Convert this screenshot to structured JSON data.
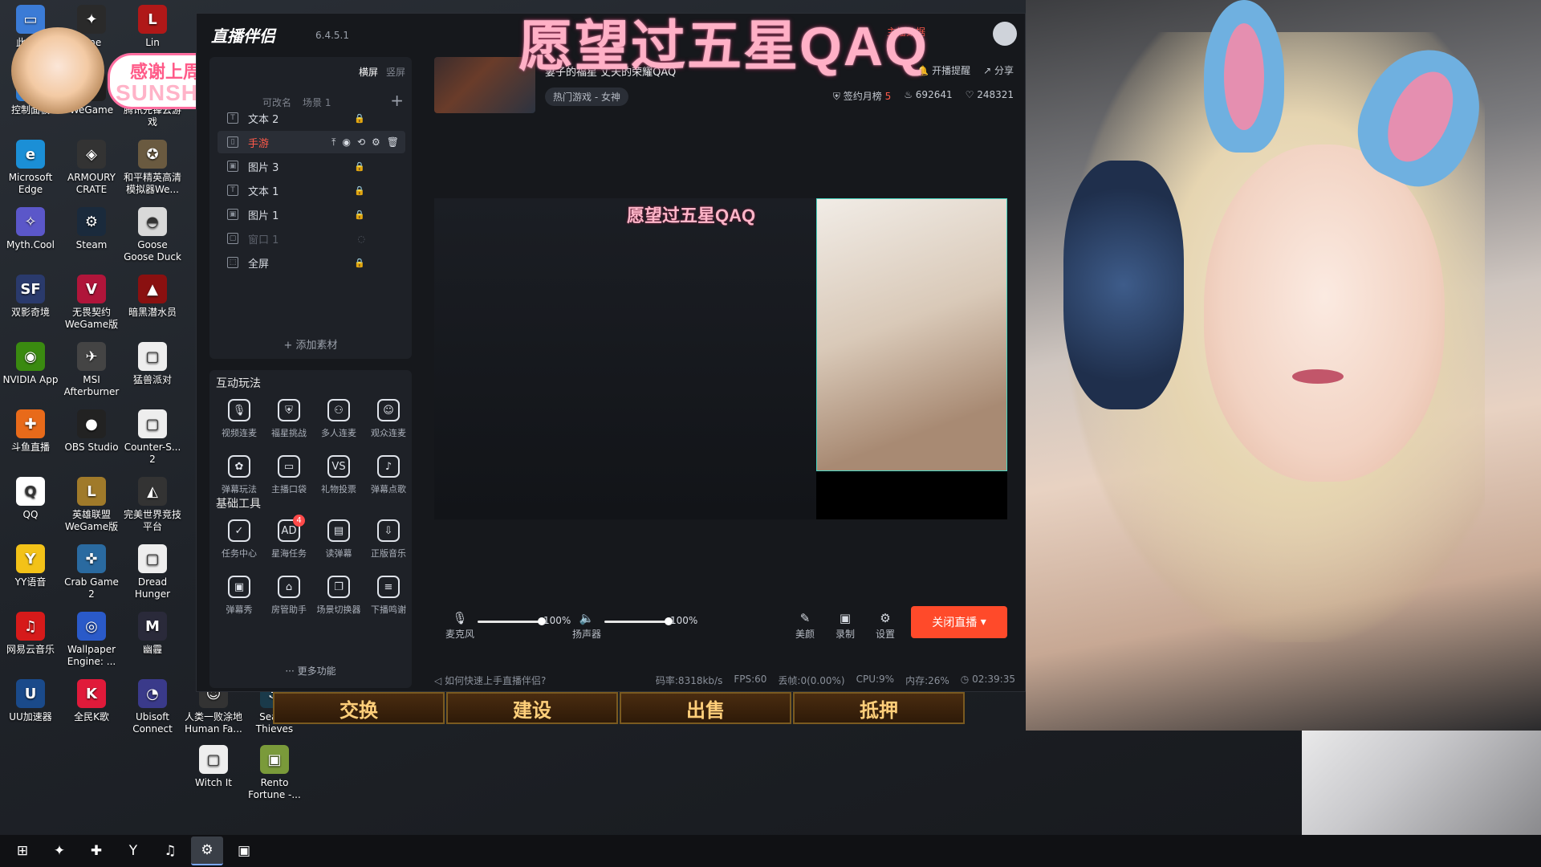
{
  "desktop": {
    "icons": [
      {
        "name": "此电脑",
        "color": "#3b7bd6",
        "glyph": "▭"
      },
      {
        "name": "One",
        "color": "#2a2a2a",
        "glyph": "✦"
      },
      {
        "name": "Lin",
        "color": "#b01818",
        "glyph": "L"
      },
      {
        "name": "控制面板",
        "color": "#2d7bd1",
        "glyph": "▦"
      },
      {
        "name": "WeGame",
        "color": "#1e1e1e",
        "glyph": "G"
      },
      {
        "name": "腾讯先锋云游戏",
        "color": "#4ac3d8",
        "glyph": "◆"
      },
      {
        "name": "Microsoft Edge",
        "color": "#1b8fd6",
        "glyph": "e"
      },
      {
        "name": "ARMOURY CRATE",
        "color": "#333",
        "glyph": "◈"
      },
      {
        "name": "和平精英高清模拟器We...",
        "color": "#6a5a40",
        "glyph": "✪"
      },
      {
        "name": "Myth.Cool",
        "color": "#5b57c9",
        "glyph": "✧"
      },
      {
        "name": "Steam",
        "color": "#1a2a3c",
        "glyph": "⚙"
      },
      {
        "name": "Goose Goose Duck",
        "color": "#d9d9d9",
        "glyph": "◓"
      },
      {
        "name": "双影奇境",
        "color": "#2a3a6c",
        "glyph": "SF"
      },
      {
        "name": "无畏契约 WeGame版",
        "color": "#b0153a",
        "glyph": "V"
      },
      {
        "name": "暗黑潜水员",
        "color": "#8a1010",
        "glyph": "▲"
      },
      {
        "name": "NVIDIA App",
        "color": "#3a8a10",
        "glyph": "◉"
      },
      {
        "name": "MSI Afterburner",
        "color": "#444",
        "glyph": "✈"
      },
      {
        "name": "猛兽派对",
        "color": "#eee",
        "glyph": "▢"
      },
      {
        "name": "斗鱼直播",
        "color": "#e86a1a",
        "glyph": "✚"
      },
      {
        "name": "OBS Studio",
        "color": "#222",
        "glyph": "●"
      },
      {
        "name": "Counter-S... 2",
        "color": "#eee",
        "glyph": "▢"
      },
      {
        "name": "QQ",
        "color": "#fff",
        "glyph": "Q"
      },
      {
        "name": "英雄联盟 WeGame版",
        "color": "#a07a2a",
        "glyph": "L"
      },
      {
        "name": "完美世界竞技平台",
        "color": "#333",
        "glyph": "◭"
      },
      {
        "name": "YY语音",
        "color": "#f3c218",
        "glyph": "Y"
      },
      {
        "name": "Crab Game 2",
        "color": "#2a6aa0",
        "glyph": "✜"
      },
      {
        "name": "Dread Hunger",
        "color": "#eee",
        "glyph": "▢"
      },
      {
        "name": "网易云音乐",
        "color": "#d61a1a",
        "glyph": "♫"
      },
      {
        "name": "Wallpaper Engine: ...",
        "color": "#2a5ac9",
        "glyph": "◎"
      },
      {
        "name": "幽霾",
        "color": "#2a2a3a",
        "glyph": "M"
      },
      {
        "name": "UU加速器",
        "color": "#1a4a8a",
        "glyph": "U"
      },
      {
        "name": "全民K歌",
        "color": "#e01a3a",
        "glyph": "K"
      },
      {
        "name": "Ubisoft Connect",
        "color": "#3a3a8a",
        "glyph": "◔"
      },
      {
        "name": "人类一败涂地 Human Fa...",
        "color": "#333",
        "glyph": "☺"
      },
      {
        "name": "Sea of Thieves",
        "color": "#1a3a4a",
        "glyph": "⚓"
      },
      {
        "name": "Witch It",
        "color": "#eee",
        "glyph": "▢"
      },
      {
        "name": "Rento Fortune -...",
        "color": "#7a9a3a",
        "glyph": "▣"
      }
    ]
  },
  "taskbar": {
    "items": [
      {
        "label": "start",
        "glyph": "⊞"
      },
      {
        "label": "app1",
        "glyph": "✦"
      },
      {
        "label": "app2",
        "glyph": "✚"
      },
      {
        "label": "yy",
        "glyph": "Y"
      },
      {
        "label": "netease",
        "glyph": "♫"
      },
      {
        "label": "steam",
        "glyph": "⚙"
      },
      {
        "label": "rento",
        "glyph": "▣"
      }
    ],
    "active_index": 5
  },
  "app": {
    "name": "直播伴侣",
    "version": "6.4.5.1",
    "orientation_tabs": [
      "横屏",
      "竖屏"
    ],
    "scene_tabs": [
      "可改名",
      "场景 1"
    ],
    "sources": [
      {
        "label": "文本 2",
        "type": "T",
        "state": "normal"
      },
      {
        "label": "手游",
        "type": "▯",
        "state": "active"
      },
      {
        "label": "图片 3",
        "type": "▣",
        "state": "normal"
      },
      {
        "label": "文本 1",
        "type": "T",
        "state": "normal"
      },
      {
        "label": "图片 1",
        "type": "▣",
        "state": "normal"
      },
      {
        "label": "窗口 1",
        "type": "▢",
        "state": "dim"
      },
      {
        "label": "全屏",
        "type": "⬚",
        "state": "normal"
      }
    ],
    "add_material": "添加素材",
    "interactive_title": "互动玩法",
    "interactive_tools": [
      "视频连麦",
      "福星挑战",
      "多人连麦",
      "观众连麦",
      "弹幕玩法",
      "主播口袋",
      "礼物投票",
      "弹幕点歌"
    ],
    "basic_title": "基础工具",
    "basic_tools": [
      "任务中心",
      "星海任务",
      "读弹幕",
      "正版音乐",
      "弹幕秀",
      "房管助手",
      "场景切换器",
      "下播鸣谢"
    ],
    "basic_badge": "4",
    "more_functions": "更多功能"
  },
  "stream": {
    "title": "妻子的福星 丈夫的荣耀QAQ",
    "category": "热门游戏 - 女神",
    "host_data": "主播数据",
    "broadcast_remind": "开播提醒",
    "share": "分享",
    "sign_month": "签约月榜",
    "sign_rank": "5",
    "popularity": "692641",
    "likes": "248321",
    "overlay_title": "愿望过五星QAQ",
    "preview_title": "愿望过五星QAQ"
  },
  "controls": {
    "mic_label": "麦克风",
    "mic_pct": "100%",
    "mic_level": 1.0,
    "speaker_label": "扬声器",
    "speaker_pct": "100%",
    "speaker_level": 1.0,
    "beauty": "美颜",
    "record": "录制",
    "settings": "设置",
    "end_live": "关闭直播"
  },
  "status": {
    "help": "如何快速上手直播伴侣?",
    "bitrate": "码率:8318kb/s",
    "fps": "FPS:60",
    "drop": "丢帧:0(0.00%)",
    "cpu": "CPU:9%",
    "memory": "内存:26%",
    "duration": "02:39:35"
  },
  "overlay_badge": {
    "line1": "感谢上周投喂",
    "line2": "SUNSHINE"
  },
  "game_bar": [
    "交换",
    "建设",
    "出售",
    "抵押"
  ]
}
